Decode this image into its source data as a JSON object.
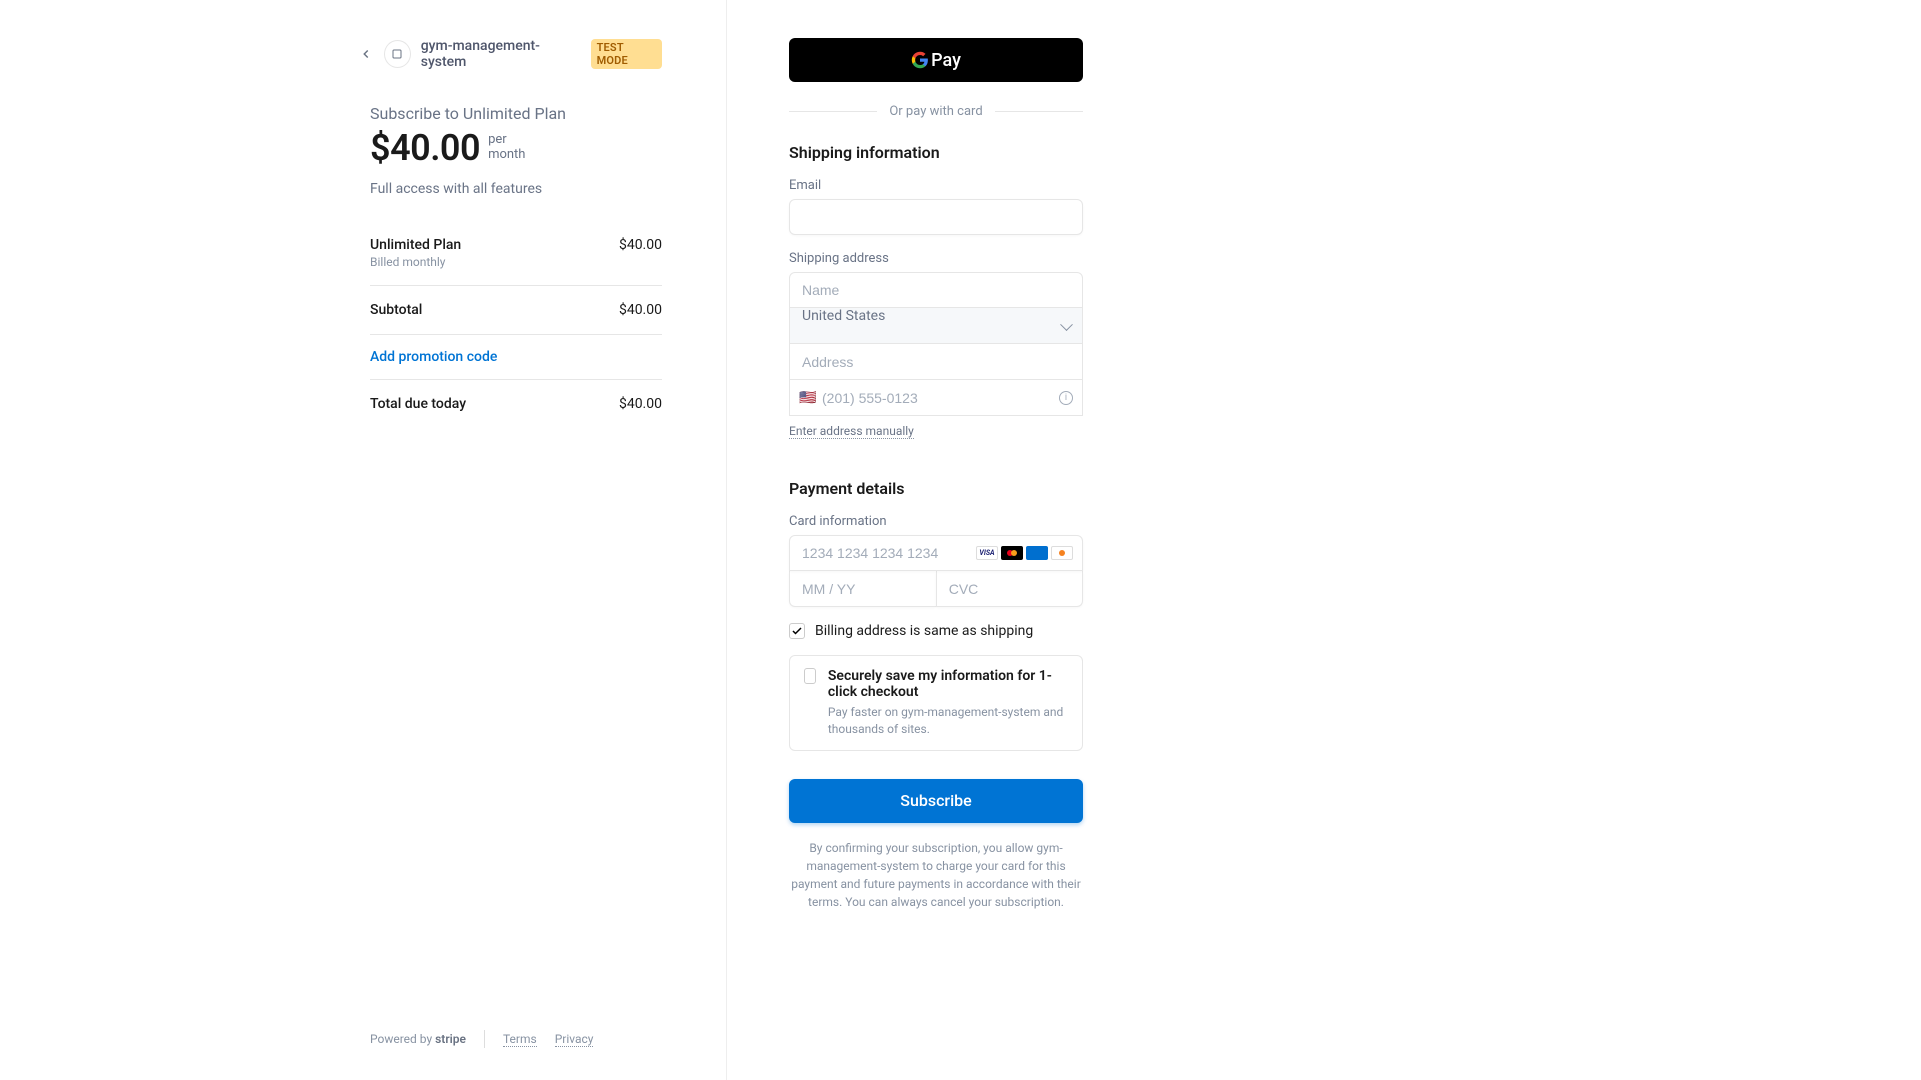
{
  "merchant": {
    "name": "gym-management-system",
    "test_badge": "TEST MODE"
  },
  "summary": {
    "title": "Subscribe to Unlimited Plan",
    "price": "$40.00",
    "interval_line1": "per",
    "interval_line2": "month",
    "description": "Full access with all features",
    "plan_name": "Unlimited Plan",
    "plan_price": "$40.00",
    "plan_billing": "Billed monthly",
    "subtotal_label": "Subtotal",
    "subtotal_amount": "$40.00",
    "promo_link": "Add promotion code",
    "total_label": "Total due today",
    "total_amount": "$40.00"
  },
  "footer": {
    "powered_by": "Powered by",
    "brand": "stripe",
    "terms": "Terms",
    "privacy": "Privacy"
  },
  "payment": {
    "gpay_label": "Pay",
    "or_text": "Or pay with card",
    "shipping_title": "Shipping information",
    "email_label": "Email",
    "shipping_address_label": "Shipping address",
    "name_placeholder": "Name",
    "country_value": "United States",
    "address_placeholder": "Address",
    "phone_placeholder": "(201) 555-0123",
    "manual_link": "Enter address manually",
    "payment_title": "Payment details",
    "card_label": "Card information",
    "card_number_placeholder": "1234 1234 1234 1234",
    "card_exp_placeholder": "MM / YY",
    "card_cvc_placeholder": "CVC",
    "billing_same": "Billing address is same as shipping",
    "save_title": "Securely save my information for 1-click checkout",
    "save_desc": "Pay faster on gym-management-system and thousands of sites.",
    "subscribe_button": "Subscribe",
    "legal": "By confirming your subscription, you allow gym-management-system to charge your card for this payment and future payments in accordance with their terms. You can always cancel your subscription."
  }
}
